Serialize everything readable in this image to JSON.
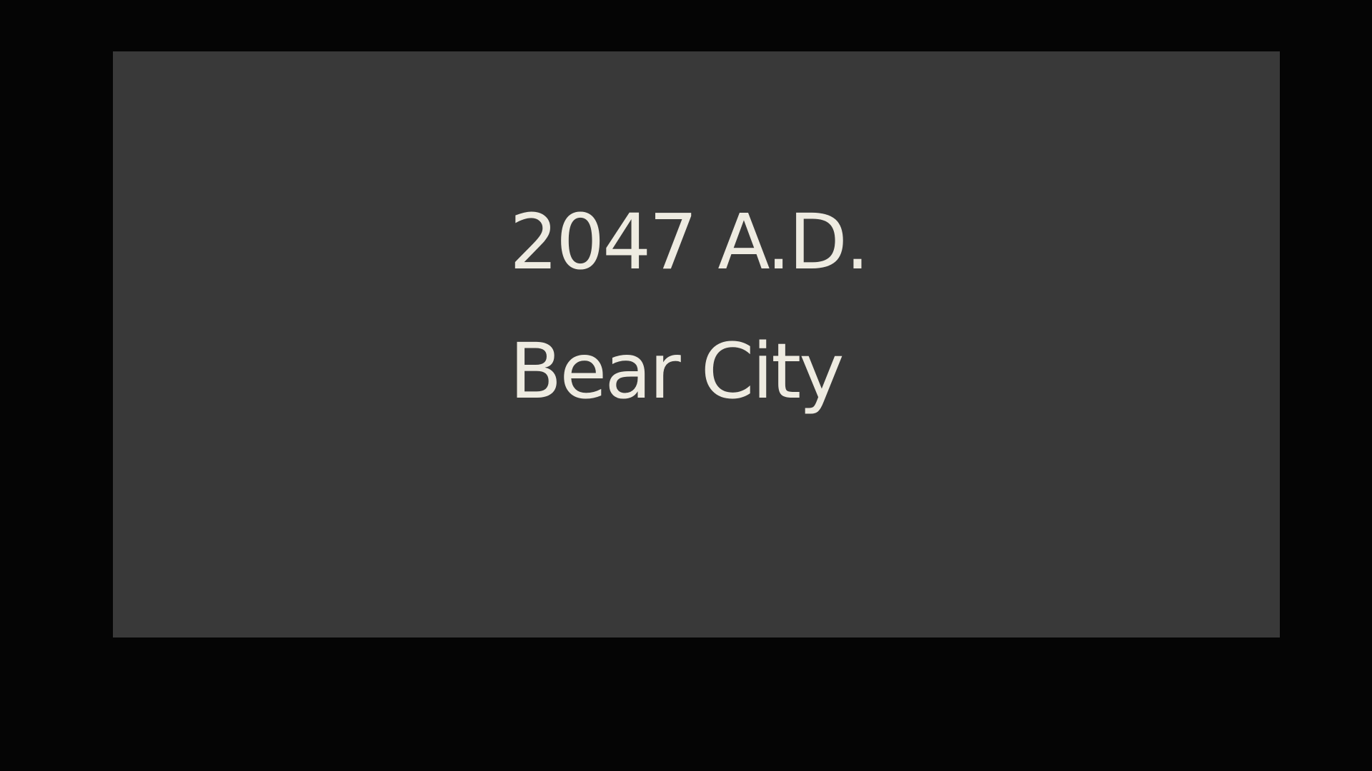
{
  "title_card": {
    "year": "2047 A.D.",
    "location": "Bear City"
  },
  "colors": {
    "letterbox": "#050505",
    "card_background": "#393939",
    "text": "#eeebe1"
  }
}
